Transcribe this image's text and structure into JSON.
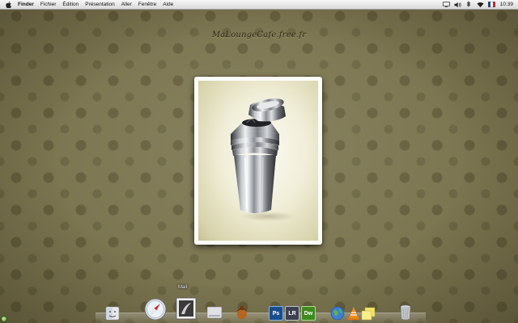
{
  "menubar": {
    "app_name": "Finder",
    "items": [
      "Fichier",
      "Édition",
      "Présentation",
      "Aller",
      "Fenêtre",
      "Aide"
    ],
    "clock": "10:39",
    "status_icons": [
      "display-icon",
      "volume-icon",
      "bluetooth-icon",
      "wifi-icon",
      "flag-icon"
    ]
  },
  "desktop": {
    "site_title": "MaLoungeCafe.free.fr"
  },
  "dock": {
    "hover_label": "Mail",
    "items": [
      "finder-icon",
      "safari-icon",
      "mail-icon",
      "hard-drive-icon",
      "cider-icon",
      "photoshop-icon",
      "lightroom-icon",
      "dreamweaver-icon",
      "globe-app-icon",
      "vlc-icon",
      "stickies-icon",
      "trash-icon"
    ],
    "adobe_labels": {
      "photoshop": "Ps",
      "lightroom": "LR",
      "dreamweaver": "Dw"
    }
  },
  "colors": {
    "wallpaper": "#7b7550",
    "photoshop": "#1b4d8c",
    "lightroom": "#3a4150",
    "dreamweaver": "#3f8a1f"
  }
}
